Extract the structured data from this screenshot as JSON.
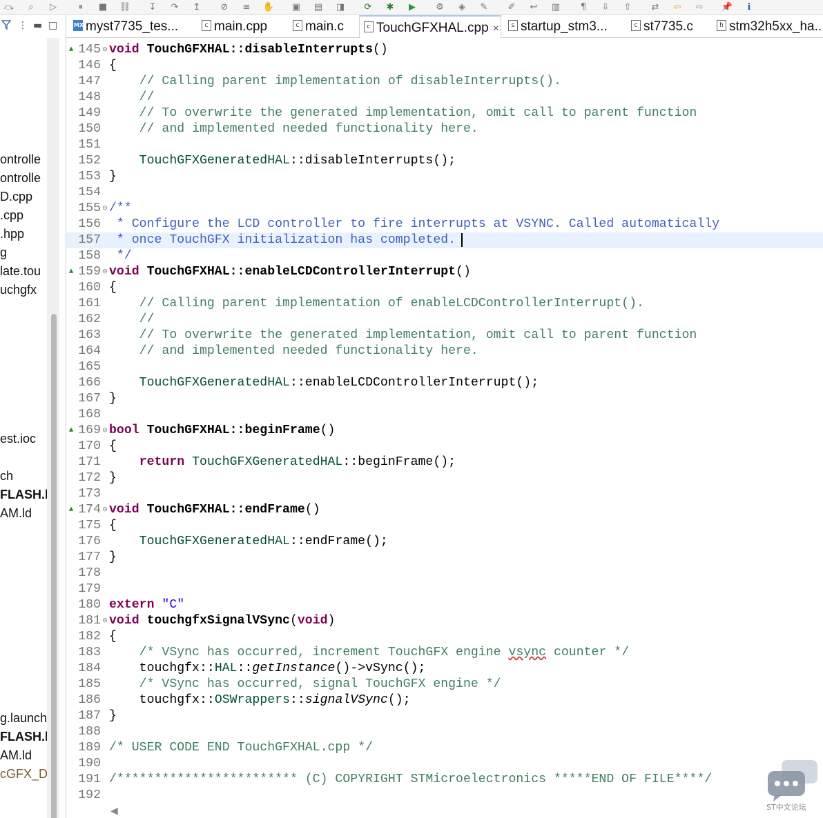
{
  "toolbar": {
    "icons": [
      "skip-icon",
      "search-icon",
      "resume-icon",
      "suspend-icon",
      "terminate-icon",
      "disconnect-icon",
      "step-into-icon",
      "step-over-icon",
      "step-return-icon",
      "toggle-breakpoints-icon",
      "instruction-step-icon",
      "build-icon",
      "new-icon",
      "new-file-icon",
      "new-class-icon",
      "refresh-icon",
      "debug-icon",
      "run-icon",
      "external-tools-icon",
      "open-type-icon",
      "search-tool-icon",
      "highlight-icon",
      "word-wrap-icon",
      "block-selection-icon",
      "show-whitespace-icon",
      "next-annotation-icon",
      "previous-annotation-icon",
      "last-edit-icon",
      "back-icon",
      "forward-icon",
      "pin-editor-icon",
      "info-icon"
    ]
  },
  "explorer": {
    "header_icons": [
      "filter-icon",
      "view-menu-icon",
      "minimize-icon",
      "maximize-icon"
    ],
    "items": [
      {
        "text": "ontrolle",
        "style": ""
      },
      {
        "text": "ontrolle",
        "style": ""
      },
      {
        "text": "D.cpp",
        "style": ""
      },
      {
        "text": ".cpp",
        "style": ""
      },
      {
        "text": ".hpp",
        "style": ""
      },
      {
        "text": "g",
        "style": ""
      },
      {
        "text": "late.tou",
        "style": ""
      },
      {
        "text": "uchgfx",
        "style": ""
      },
      {
        "text": "est.ioc",
        "style": ""
      },
      {
        "text": "ch",
        "style": ""
      },
      {
        "text": "FLASH.l",
        "style": "bold"
      },
      {
        "text": "AM.ld",
        "style": ""
      },
      {
        "text": "g.launch",
        "style": ""
      },
      {
        "text": "FLASH.l",
        "style": "bold"
      },
      {
        "text": "AM.ld",
        "style": ""
      },
      {
        "text": "cGFX_D",
        "style": "brown"
      }
    ]
  },
  "tabs": [
    {
      "label": "myst7735_tes...",
      "icon": "MX",
      "active": false
    },
    {
      "label": "main.cpp",
      "icon": "c",
      "active": false
    },
    {
      "label": "main.c",
      "icon": "c",
      "active": false
    },
    {
      "label": "TouchGFXHAL.cpp",
      "icon": "c",
      "active": true,
      "close": "×"
    },
    {
      "label": "startup_stm3...",
      "icon": "s",
      "active": false
    },
    {
      "label": "st7735.c",
      "icon": "c",
      "active": false
    },
    {
      "label": "stm32h5xx_ha...",
      "icon": "h",
      "active": false
    }
  ],
  "editor": {
    "lines": [
      {
        "n": "145",
        "fold": "⊖",
        "ovr": "▲",
        "t": [
          [
            "kw",
            "void "
          ],
          [
            "fn",
            "TouchGFXHAL::disableInterrupts"
          ],
          [
            "pl",
            "()"
          ]
        ]
      },
      {
        "n": "146",
        "t": [
          [
            "pl",
            "{"
          ]
        ]
      },
      {
        "n": "147",
        "t": [
          [
            "cm",
            "    // Calling parent implementation of disableInterrupts()."
          ]
        ]
      },
      {
        "n": "148",
        "t": [
          [
            "cm",
            "    //"
          ]
        ]
      },
      {
        "n": "149",
        "t": [
          [
            "cm",
            "    // To overwrite the generated implementation, omit call to parent function"
          ]
        ]
      },
      {
        "n": "150",
        "t": [
          [
            "cm",
            "    // and implemented needed functionality here."
          ]
        ]
      },
      {
        "n": "151",
        "t": []
      },
      {
        "n": "152",
        "t": [
          [
            "cls",
            "    TouchGFXGeneratedHAL"
          ],
          [
            "pl",
            "::disableInterrupts();"
          ]
        ]
      },
      {
        "n": "153",
        "t": [
          [
            "pl",
            "}"
          ]
        ]
      },
      {
        "n": "154",
        "t": []
      },
      {
        "n": "155",
        "fold": "⊖",
        "t": [
          [
            "jd",
            "/**"
          ]
        ]
      },
      {
        "n": "156",
        "t": [
          [
            "jd",
            " * Configure the LCD controller to fire interrupts at VSYNC. Called automatically"
          ]
        ]
      },
      {
        "n": "157",
        "current": true,
        "t": [
          [
            "jd",
            " * once TouchGFX initialization has completed."
          ]
        ]
      },
      {
        "n": "158",
        "t": [
          [
            "jd",
            " */"
          ]
        ]
      },
      {
        "n": "159",
        "fold": "⊖",
        "ovr": "▲",
        "t": [
          [
            "kw",
            "void "
          ],
          [
            "fn",
            "TouchGFXHAL::enableLCDControllerInterrupt"
          ],
          [
            "pl",
            "()"
          ]
        ]
      },
      {
        "n": "160",
        "t": [
          [
            "pl",
            "{"
          ]
        ]
      },
      {
        "n": "161",
        "t": [
          [
            "cm",
            "    // Calling parent implementation of enableLCDControllerInterrupt()."
          ]
        ]
      },
      {
        "n": "162",
        "t": [
          [
            "cm",
            "    //"
          ]
        ]
      },
      {
        "n": "163",
        "t": [
          [
            "cm",
            "    // To overwrite the generated implementation, omit call to parent function"
          ]
        ]
      },
      {
        "n": "164",
        "t": [
          [
            "cm",
            "    // and implemented needed functionality here."
          ]
        ]
      },
      {
        "n": "165",
        "t": []
      },
      {
        "n": "166",
        "t": [
          [
            "cls",
            "    TouchGFXGeneratedHAL"
          ],
          [
            "pl",
            "::enableLCDControllerInterrupt();"
          ]
        ]
      },
      {
        "n": "167",
        "t": [
          [
            "pl",
            "}"
          ]
        ]
      },
      {
        "n": "168",
        "t": []
      },
      {
        "n": "169",
        "fold": "⊖",
        "ovr": "▲",
        "t": [
          [
            "kw",
            "bool "
          ],
          [
            "fn",
            "TouchGFXHAL::beginFrame"
          ],
          [
            "pl",
            "()"
          ]
        ]
      },
      {
        "n": "170",
        "t": [
          [
            "pl",
            "{"
          ]
        ]
      },
      {
        "n": "171",
        "t": [
          [
            "kw",
            "    return "
          ],
          [
            "cls",
            "TouchGFXGeneratedHAL"
          ],
          [
            "pl",
            "::beginFrame();"
          ]
        ]
      },
      {
        "n": "172",
        "t": [
          [
            "pl",
            "}"
          ]
        ]
      },
      {
        "n": "173",
        "t": []
      },
      {
        "n": "174",
        "fold": "⊖",
        "ovr": "▲",
        "t": [
          [
            "kw",
            "void "
          ],
          [
            "fn",
            "TouchGFXHAL::endFrame"
          ],
          [
            "pl",
            "()"
          ]
        ]
      },
      {
        "n": "175",
        "t": [
          [
            "pl",
            "{"
          ]
        ]
      },
      {
        "n": "176",
        "t": [
          [
            "cls",
            "    TouchGFXGeneratedHAL"
          ],
          [
            "pl",
            "::endFrame();"
          ]
        ]
      },
      {
        "n": "177",
        "t": [
          [
            "pl",
            "}"
          ]
        ]
      },
      {
        "n": "178",
        "t": []
      },
      {
        "n": "179",
        "t": []
      },
      {
        "n": "180",
        "t": [
          [
            "kw",
            "extern "
          ],
          [
            "str",
            "\"C\""
          ]
        ]
      },
      {
        "n": "181",
        "fold": "⊖",
        "t": [
          [
            "kw",
            "void "
          ],
          [
            "fn",
            "touchgfxSignalVSync"
          ],
          [
            "pl",
            "("
          ],
          [
            "kw",
            "void"
          ],
          [
            "pl",
            ")"
          ]
        ]
      },
      {
        "n": "182",
        "t": [
          [
            "pl",
            "{"
          ]
        ]
      },
      {
        "n": "183",
        "t": [
          [
            "cm",
            "    /* VSync has occurred, increment TouchGFX engine "
          ],
          [
            "cm squiggle",
            "vsync"
          ],
          [
            "cm",
            " counter */"
          ]
        ]
      },
      {
        "n": "184",
        "t": [
          [
            "pl",
            "    touchgfx::"
          ],
          [
            "cls",
            "HAL"
          ],
          [
            "pl",
            "::"
          ],
          [
            "pl it",
            "getInstance"
          ],
          [
            "pl",
            "()->vSync();"
          ]
        ]
      },
      {
        "n": "185",
        "t": [
          [
            "cm",
            "    /* VSync has occurred, signal TouchGFX engine */"
          ]
        ]
      },
      {
        "n": "186",
        "t": [
          [
            "pl",
            "    touchgfx::"
          ],
          [
            "cls",
            "OSWrappers"
          ],
          [
            "pl",
            "::"
          ],
          [
            "pl it",
            "signalVSync"
          ],
          [
            "pl",
            "();"
          ]
        ]
      },
      {
        "n": "187",
        "t": [
          [
            "pl",
            "}"
          ]
        ]
      },
      {
        "n": "188",
        "t": []
      },
      {
        "n": "189",
        "t": [
          [
            "cm",
            "/* USER CODE END TouchGFXHAL.cpp */"
          ]
        ]
      },
      {
        "n": "190",
        "t": []
      },
      {
        "n": "191",
        "t": [
          [
            "cm",
            "/************************ (C) COPYRIGHT STMicroelectronics *****END OF FILE****/"
          ]
        ]
      },
      {
        "n": "192",
        "t": []
      }
    ]
  },
  "watermark": {
    "text": "ST中文论坛",
    "icon": "chat-bubble-icon"
  },
  "colors": {
    "keyword": "#7f0055",
    "comment": "#3f7f5f",
    "javadoc": "#3f5fbf",
    "class": "#005032",
    "string": "#2a00ff",
    "line_number": "#787878",
    "current_line": "#e8f2fe"
  }
}
